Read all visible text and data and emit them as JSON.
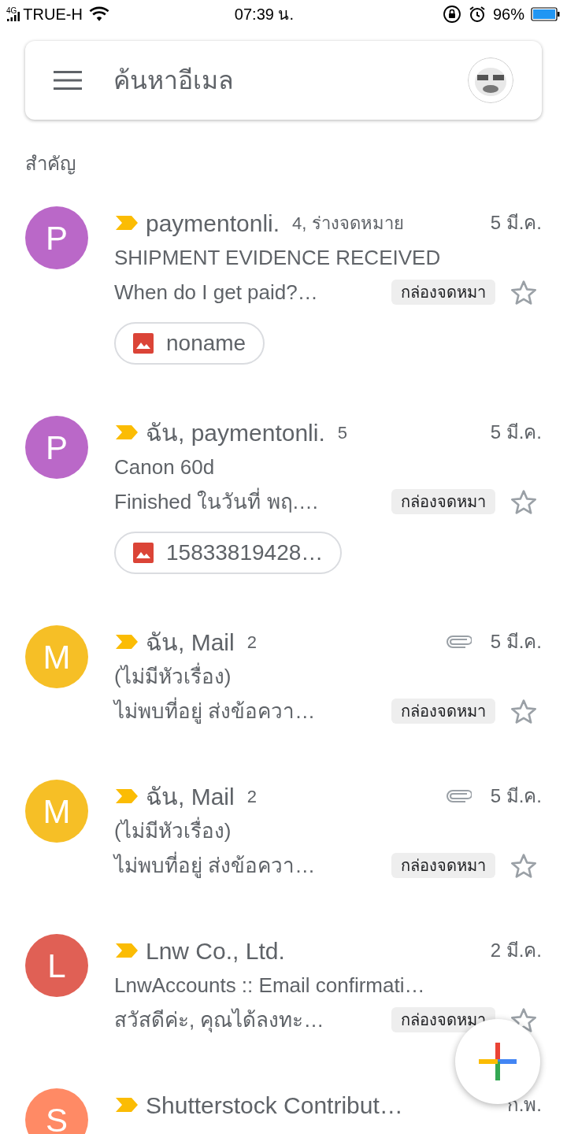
{
  "status_bar": {
    "network": "4G",
    "carrier": "TRUE-H",
    "time": "07:39 น.",
    "battery": "96%"
  },
  "search": {
    "placeholder": "ค้นหาอีเมล"
  },
  "section": "สำคัญ",
  "emails": [
    {
      "initial": "P",
      "color": "#ba68c8",
      "sender": "paymentonli.",
      "count": "4, ร่างจดหมาย",
      "paperclip": false,
      "date": "5 มี.ค.",
      "important": true,
      "subject": "SHIPMENT EVIDENCE RECEIVED",
      "preview": "When do I get paid?…",
      "label": "กล่องจดหมา",
      "starred": false,
      "attachment": "noname"
    },
    {
      "initial": "P",
      "color": "#ba68c8",
      "sender": "ฉัน, paymentonli.",
      "count": "5",
      "paperclip": false,
      "date": "5 มี.ค.",
      "important": true,
      "subject": "Canon 60d",
      "preview": "Finished ในวันที่ พฤ.…",
      "label": "กล่องจดหมา",
      "starred": false,
      "attachment": "15833819428…"
    },
    {
      "initial": "M",
      "color": "#f6bf26",
      "sender": "ฉัน, Mail",
      "count": "2",
      "paperclip": true,
      "date": "5 มี.ค.",
      "important": true,
      "subject": "(ไม่มีหัวเรื่อง)",
      "preview": "ไม่พบที่อยู่ ส่งข้อควา…",
      "label": "กล่องจดหมา",
      "starred": false
    },
    {
      "initial": "M",
      "color": "#f6bf26",
      "sender": "ฉัน, Mail",
      "count": "2",
      "paperclip": true,
      "date": "5 มี.ค.",
      "important": true,
      "subject": "(ไม่มีหัวเรื่อง)",
      "preview": "ไม่พบที่อยู่ ส่งข้อควา…",
      "label": "กล่องจดหมา",
      "starred": false
    },
    {
      "initial": "L",
      "color": "#e06055",
      "sender": "Lnw Co., Ltd.",
      "paperclip": false,
      "date": "2 มี.ค.",
      "important": true,
      "subject": "LnwAccounts :: Email confirmati…",
      "preview": "สวัสดีค่ะ, คุณได้ลงทะ…",
      "label": "กล่องจดหมา",
      "starred": false
    },
    {
      "initial": "S",
      "color": "#ff8a65",
      "sender": "Shutterstock Contribut…",
      "paperclip": false,
      "date": "ก.พ.",
      "important": true
    }
  ]
}
